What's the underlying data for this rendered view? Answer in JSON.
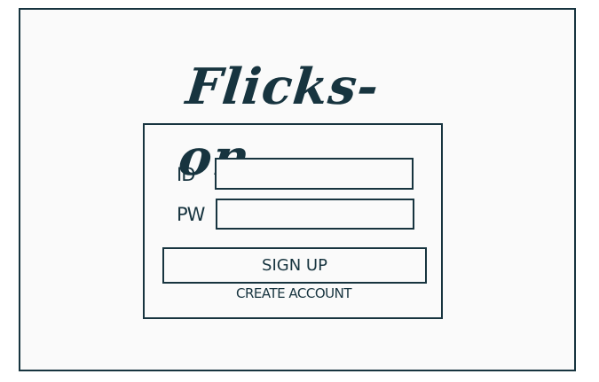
{
  "app": {
    "logo_text": "Flicks-on"
  },
  "login": {
    "id_label": "ID",
    "pw_label": "PW",
    "id_value": "",
    "pw_value": "",
    "signup_label": "SIGN UP",
    "create_account_label": "CREATE ACCOUNT"
  },
  "colors": {
    "ink": "#17343f",
    "background": "#fafafa"
  }
}
